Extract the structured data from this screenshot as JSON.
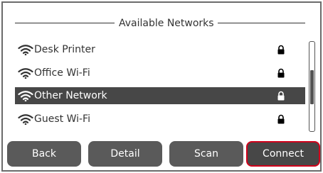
{
  "header": {
    "title": "Available Networks"
  },
  "networks": [
    {
      "name": "Desk Printer",
      "icon": "wifi-icon",
      "secured": true,
      "selected": false
    },
    {
      "name": "Office Wi-Fi",
      "icon": "wifi-icon",
      "secured": true,
      "selected": false
    },
    {
      "name": "Other Network",
      "icon": "wifi-icon",
      "secured": true,
      "selected": true
    },
    {
      "name": "Guest Wi-Fi",
      "icon": "wifi-icon",
      "secured": true,
      "selected": false
    }
  ],
  "buttons": {
    "back": "Back",
    "detail": "Detail",
    "scan": "Scan",
    "connect": "Connect"
  },
  "colors": {
    "selection": "#474747",
    "button": "#5a5a5a",
    "focus_outline": "#d0021b",
    "text": "#333333"
  }
}
